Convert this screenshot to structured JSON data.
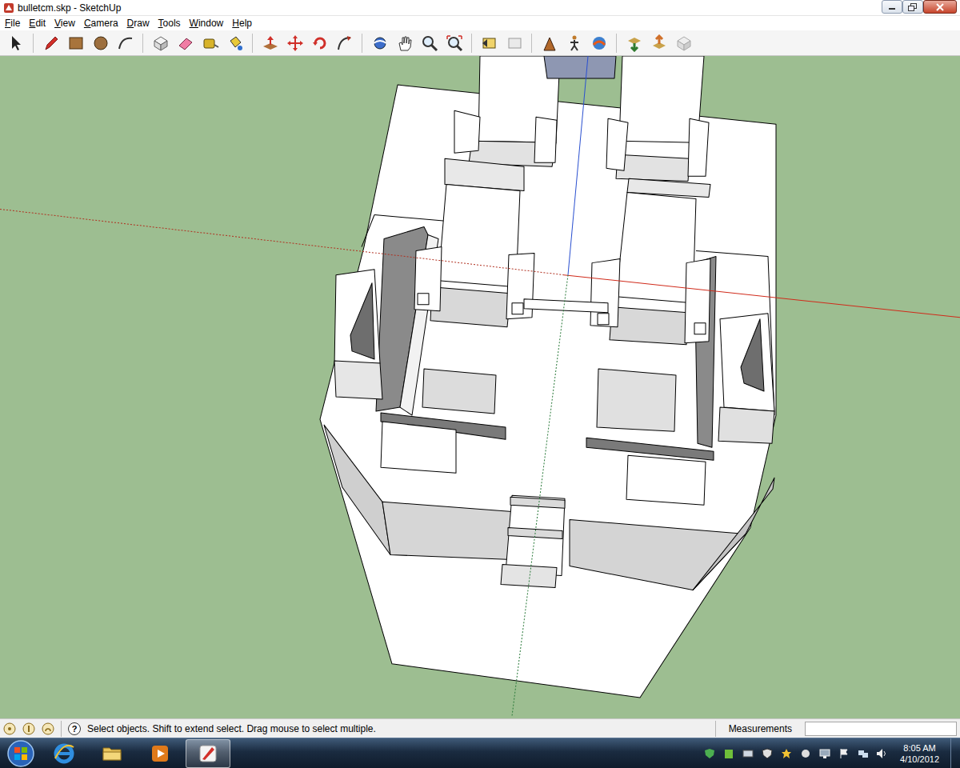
{
  "window": {
    "title": "bulletcm.skp - SketchUp"
  },
  "menu": [
    "File",
    "Edit",
    "View",
    "Camera",
    "Draw",
    "Tools",
    "Window",
    "Help"
  ],
  "status_bar": {
    "help": "?",
    "hint": "Select objects. Shift to extend select. Drag mouse to select multiple.",
    "measurements_label": "Measurements"
  },
  "taskbar": {
    "apps": [
      {
        "kind": "browser",
        "selected": false
      },
      {
        "kind": "folder",
        "selected": false
      },
      {
        "kind": "media",
        "selected": false
      },
      {
        "kind": "sketchup",
        "selected": true
      }
    ],
    "clock": {
      "time": "8:05 AM",
      "date": "4/10/2012"
    }
  }
}
